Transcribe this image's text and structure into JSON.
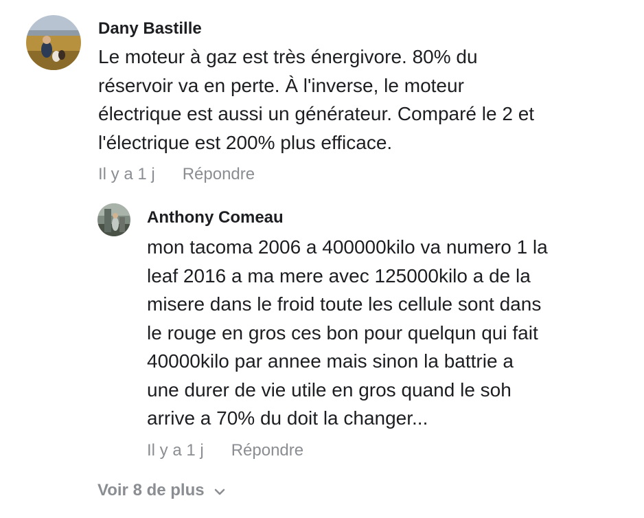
{
  "comments": [
    {
      "author": "Dany Bastille",
      "text": "Le moteur à gaz est très énergivore. 80% du\nréservoir va en perte. À l'inverse, le moteur\nélectrique est aussi un générateur. Comparé le 2 et\nl'électrique est 200% plus efficace.",
      "time": "Il y a 1 j",
      "reply_label": "Répondre"
    },
    {
      "author": "Anthony Comeau",
      "text": "mon tacoma 2006 a 400000kilo va numero 1 la\nleaf 2016 a ma mere avec 125000kilo a de la\nmisere dans le froid toute les cellule sont dans\nle rouge en gros ces bon pour quelqun qui fait\n40000kilo par annee mais sinon la battrie a\nune durer de vie utile en gros quand le soh\narrive a 70% du doit la changer...",
      "time": "Il y a 1 j",
      "reply_label": "Répondre"
    }
  ],
  "more_replies": {
    "label": "Voir 8 de plus",
    "icon": "chevron-down-icon"
  },
  "colors": {
    "text": "#1c1e21",
    "meta": "#8a8d91"
  }
}
